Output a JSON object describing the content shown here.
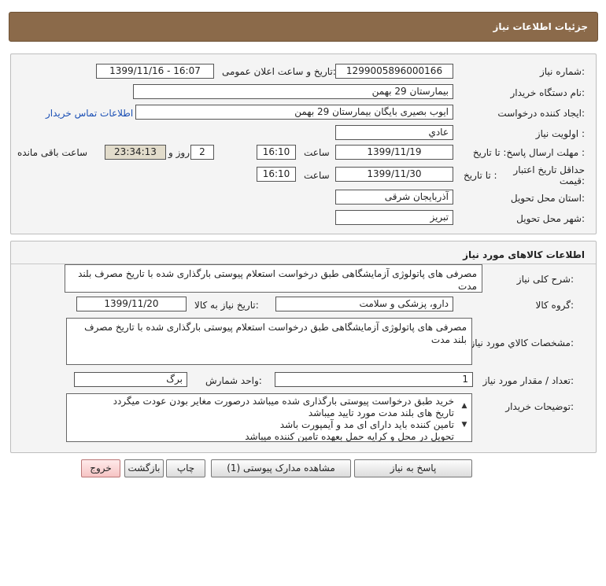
{
  "header": {
    "title": "جزئیات اطلاعات نیاز"
  },
  "need_info": {
    "need_number_label": "شماره نیاز:",
    "need_number": "1299005896000166",
    "announce_label": "تاریخ و ساعت اعلان عمومی:",
    "announce_value": "1399/11/16 - 16:07",
    "buyer_org_label": "نام دستگاه خریدار:",
    "buyer_org": "بیمارستان 29 بهمن",
    "requester_label": "ایجاد کننده درخواست:",
    "requester": "ایوب بصیری  بایگان بیمارستان 29 بهمن",
    "contact_link": "اطلاعات تماس خریدار",
    "priority_label": "اولویت نیاز :",
    "priority": "عادي",
    "deadline_label": "مهلت ارسال پاسخ: تا تاریخ :",
    "deadline_date": "1399/11/19",
    "time_label": "ساعت",
    "deadline_time": "16:10",
    "days_value": "2",
    "days_label": "روز و",
    "remaining_time": "23:34:13",
    "remaining_label": "ساعت باقی مانده",
    "validity_label_1": "حداقل تاریخ اعتبار",
    "validity_label_2": "قیمت:",
    "validity_date_label": "تا تاریخ :",
    "validity_date": "1399/11/30",
    "validity_time": "16:10",
    "province_label": "استان محل تحویل:",
    "province": "آذربایجان شرقی",
    "city_label": "شهر محل تحویل:",
    "city": "تبریز"
  },
  "goods": {
    "section_title": "اطلاعات کالاهای مورد نیاز",
    "general_desc_label": "شرح کلی نیاز:",
    "general_desc": "مصرفی های پاتولوژی آزمایشگاهی طبق درخواست استعلام پیوستی بارگذاری شده با تاریخ مصرف بلند مدت",
    "group_label": "گروه کالا:",
    "group": "دارو، پزشکی و سلامت",
    "need_date_label": "تاریخ نیاز به کالا:",
    "need_date": "1399/11/20",
    "specs_label": "مشخصات کالاي مورد نیاز:",
    "specs": "مصرفی های پاتولوژی آزمایشگاهی طبق درخواست استعلام پیوستی بارگذاری شده با تاریخ مصرف بلند مدت",
    "qty_label": "تعداد / مقدار مورد نیاز:",
    "qty": "1",
    "unit_label": "واحد شمارش:",
    "unit": "برگ",
    "notes_label": "توضیحات خریدار:",
    "notes": [
      "خرید طبق درخواست پیوستی بارگذاری شده میباشد درصورت مغایر بودن عودت میگردد",
      "تاریخ های بلند مدت مورد تایید میباشد",
      "تامین کننده باید دارای ای مد و آیمپورت باشد",
      "تحویل در محل و کرایه حمل بعهده تامین کننده میباشد"
    ]
  },
  "buttons": {
    "reply": "پاسخ به نیاز",
    "attachments": "مشاهده مدارک پیوستی (1)",
    "print": "چاپ",
    "back": "بازگشت",
    "exit": "خروج"
  }
}
